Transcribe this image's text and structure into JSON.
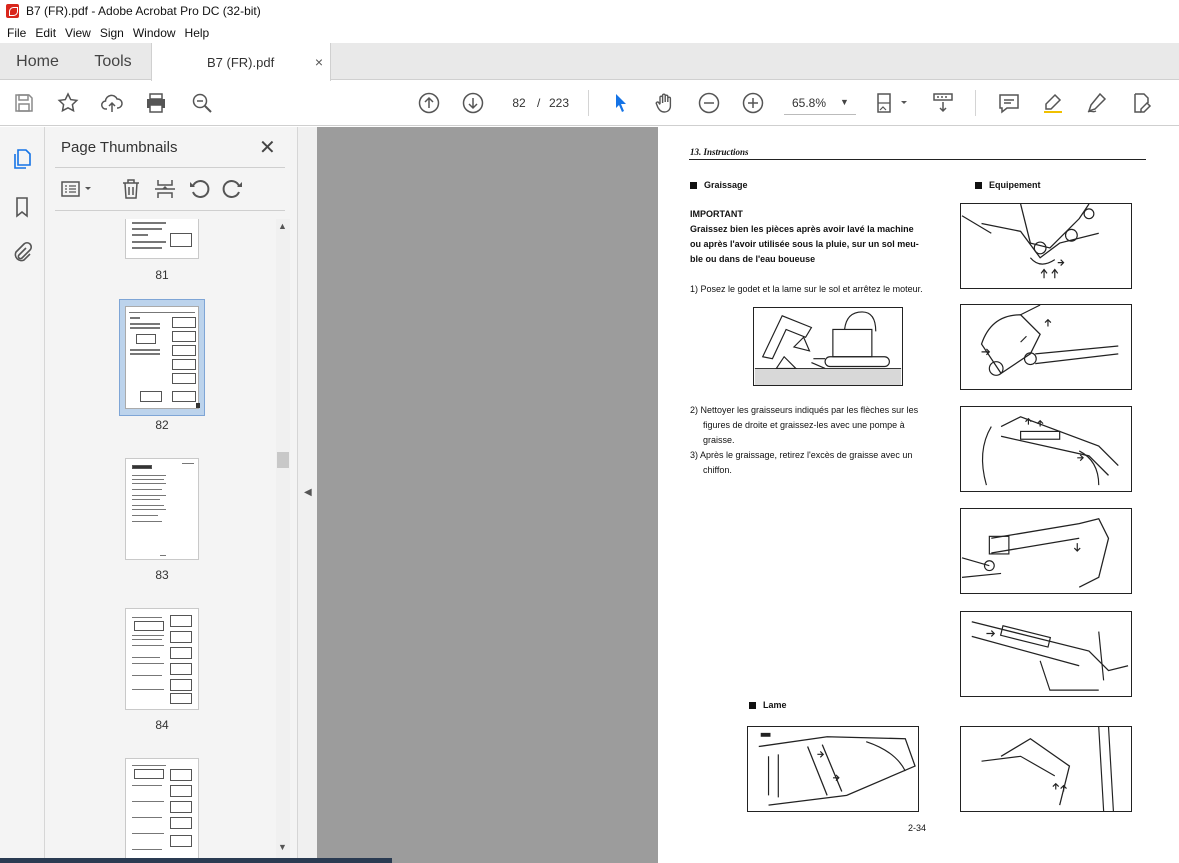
{
  "window": {
    "title": "B7  (FR).pdf - Adobe Acrobat Pro DC (32-bit)"
  },
  "menu": [
    "File",
    "Edit",
    "View",
    "Sign",
    "Window",
    "Help"
  ],
  "tabs": {
    "home": "Home",
    "tools": "Tools",
    "document": "B7  (FR).pdf",
    "close_glyph": "×"
  },
  "toolbar": {
    "current_page": "82",
    "separator": "/",
    "total_pages": "223",
    "zoom": "65.8%",
    "zoom_arrow": "▼"
  },
  "thumbnails_panel": {
    "title": "Page Thumbnails",
    "close_glyph": "✕",
    "pages": [
      "81",
      "82",
      "83",
      "84",
      ""
    ]
  },
  "collapse_arrow": "◀",
  "document": {
    "header": "13. Instructions",
    "section_left": "Graissage",
    "section_right": "Equipement",
    "important_title": "IMPORTANT",
    "important_lines": [
      "Graissez bien les pièces après avoir lavé la machine",
      "ou après l'avoir utilisée sous la pluie, sur un sol meu-",
      "ble ou dans de l'eau boueuse"
    ],
    "step1": "1) Posez le godet et la lame sur le sol et arrêtez le moteur.",
    "step2_lines": [
      "2) Nettoyer les graisseurs indiqués par les flèches sur les",
      "figures de droite et graissez-les avec une pompe à",
      "graisse."
    ],
    "step3_lines": [
      "3) Après le graissage, retirez l'excès de graisse avec un",
      "chiffon."
    ],
    "section_blade": "Lame",
    "page_number": "2-34"
  }
}
